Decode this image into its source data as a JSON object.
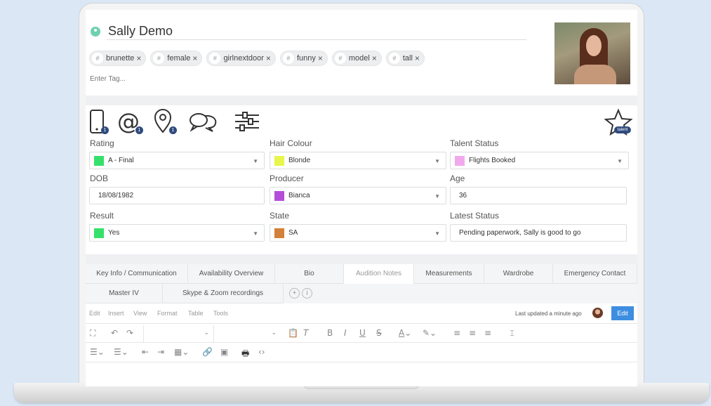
{
  "profile": {
    "name": "Sally Demo",
    "tags": [
      "brunette",
      "female",
      "girlnextdoor",
      "funny",
      "model",
      "tall"
    ],
    "tag_placeholder": "Enter Tag...",
    "tag_hash": "#",
    "tag_remove": "×"
  },
  "icons": {
    "phone_badge": "1",
    "email_badge": "1",
    "location_badge": "1",
    "talent_label": "talent"
  },
  "fields": {
    "rating": {
      "label": "Rating",
      "value": "A - Final",
      "color": "#36e06a"
    },
    "hair_colour": {
      "label": "Hair Colour",
      "value": "Blonde",
      "color": "#e8f54a"
    },
    "talent_status": {
      "label": "Talent Status",
      "value": "Flights Booked",
      "color": "#f2a9ec"
    },
    "dob": {
      "label": "DOB",
      "value": "18/08/1982"
    },
    "producer": {
      "label": "Producer",
      "value": "Bianca",
      "color": "#b44ed8"
    },
    "age": {
      "label": "Age",
      "value": "36"
    },
    "result": {
      "label": "Result",
      "value": "Yes",
      "color": "#36e06a"
    },
    "state": {
      "label": "State",
      "value": "SA",
      "color": "#d2803a"
    },
    "latest_status": {
      "label": "Latest Status",
      "value": "Pending paperwork, Sally is good to go"
    }
  },
  "tabs": {
    "row1": [
      "Key Info / Communication",
      "Availability Overview",
      "Bio",
      "Audition Notes",
      "Measurements",
      "Wardrobe",
      "Emergency Contact"
    ],
    "row2": [
      "Master IV",
      "Skype & Zoom recordings"
    ],
    "active": "Audition Notes",
    "add_symbol": "+",
    "info_symbol": "i"
  },
  "editor": {
    "menu": [
      "Edit",
      "Insert",
      "View",
      "Format",
      "Table",
      "Tools"
    ],
    "last_updated": "Last updated a minute ago",
    "edit_label": "Edit"
  }
}
